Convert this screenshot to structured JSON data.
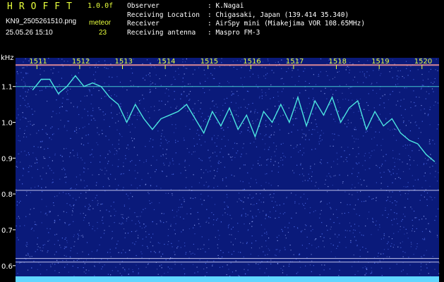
{
  "header": {
    "app_title": "HROFFT",
    "version": "1.0.0f",
    "filename": "KN9_2505261510.png",
    "datetime": "25.05.26 15:10",
    "meteor_label": "meteor",
    "meteor_count": "23"
  },
  "info": [
    {
      "key": "Observer",
      "value": ": K.Nagai"
    },
    {
      "key": "Receiving Location",
      "value": ": Chigasaki, Japan (139.414 35.340)"
    },
    {
      "key": "Receiver",
      "value": ": AirSpy mini (Miakejima VOR 108.65MHz)"
    },
    {
      "key": "Receiving antenna",
      "value": ": Maspro FM-3"
    }
  ],
  "axes": {
    "y_unit": "kHz",
    "y_ticks": [
      "1.1",
      "1.0",
      "0.9",
      "0.8",
      "0.7",
      "0.6"
    ],
    "y_values": [
      1.1,
      1.0,
      0.9,
      0.8,
      0.7,
      0.6
    ],
    "y_range": [
      0.57,
      1.18
    ],
    "x_ticks": [
      "1511",
      "1512",
      "1513",
      "1514",
      "1515",
      "1516",
      "1517",
      "1518",
      "1519",
      "1520"
    ],
    "x_values": [
      1511,
      1512,
      1513,
      1514,
      1515,
      1516,
      1517,
      1518,
      1519,
      1520
    ],
    "x_range": [
      1510.5,
      1520.4
    ]
  },
  "colors": {
    "background": "#000000",
    "spectrogram": "#0a1a7a",
    "noise": "#5a7cff",
    "signal": "#4ce6e0",
    "tick": "#e8ff3c",
    "line": "#e0e0ff"
  },
  "spectrogram": {
    "horizontal_lines_khz": [
      1.16,
      1.1,
      0.81,
      0.62,
      0.61
    ],
    "trace": [
      [
        1510.9,
        1.09
      ],
      [
        1511.1,
        1.12
      ],
      [
        1511.3,
        1.12
      ],
      [
        1511.5,
        1.08
      ],
      [
        1511.7,
        1.1
      ],
      [
        1511.9,
        1.13
      ],
      [
        1512.1,
        1.1
      ],
      [
        1512.3,
        1.11
      ],
      [
        1512.5,
        1.1
      ],
      [
        1512.7,
        1.07
      ],
      [
        1512.9,
        1.05
      ],
      [
        1513.1,
        1.0
      ],
      [
        1513.3,
        1.05
      ],
      [
        1513.5,
        1.01
      ],
      [
        1513.7,
        0.98
      ],
      [
        1513.9,
        1.01
      ],
      [
        1514.1,
        1.02
      ],
      [
        1514.3,
        1.03
      ],
      [
        1514.5,
        1.05
      ],
      [
        1514.7,
        1.01
      ],
      [
        1514.9,
        0.97
      ],
      [
        1515.1,
        1.03
      ],
      [
        1515.3,
        0.99
      ],
      [
        1515.5,
        1.04
      ],
      [
        1515.7,
        0.98
      ],
      [
        1515.9,
        1.02
      ],
      [
        1516.1,
        0.96
      ],
      [
        1516.3,
        1.03
      ],
      [
        1516.5,
        1.0
      ],
      [
        1516.7,
        1.05
      ],
      [
        1516.9,
        1.0
      ],
      [
        1517.1,
        1.07
      ],
      [
        1517.3,
        0.99
      ],
      [
        1517.5,
        1.06
      ],
      [
        1517.7,
        1.02
      ],
      [
        1517.9,
        1.07
      ],
      [
        1518.1,
        1.0
      ],
      [
        1518.3,
        1.04
      ],
      [
        1518.5,
        1.06
      ],
      [
        1518.7,
        0.98
      ],
      [
        1518.9,
        1.03
      ],
      [
        1519.1,
        0.99
      ],
      [
        1519.3,
        1.01
      ],
      [
        1519.5,
        0.97
      ],
      [
        1519.7,
        0.95
      ],
      [
        1519.9,
        0.94
      ],
      [
        1520.1,
        0.91
      ],
      [
        1520.3,
        0.89
      ]
    ]
  }
}
